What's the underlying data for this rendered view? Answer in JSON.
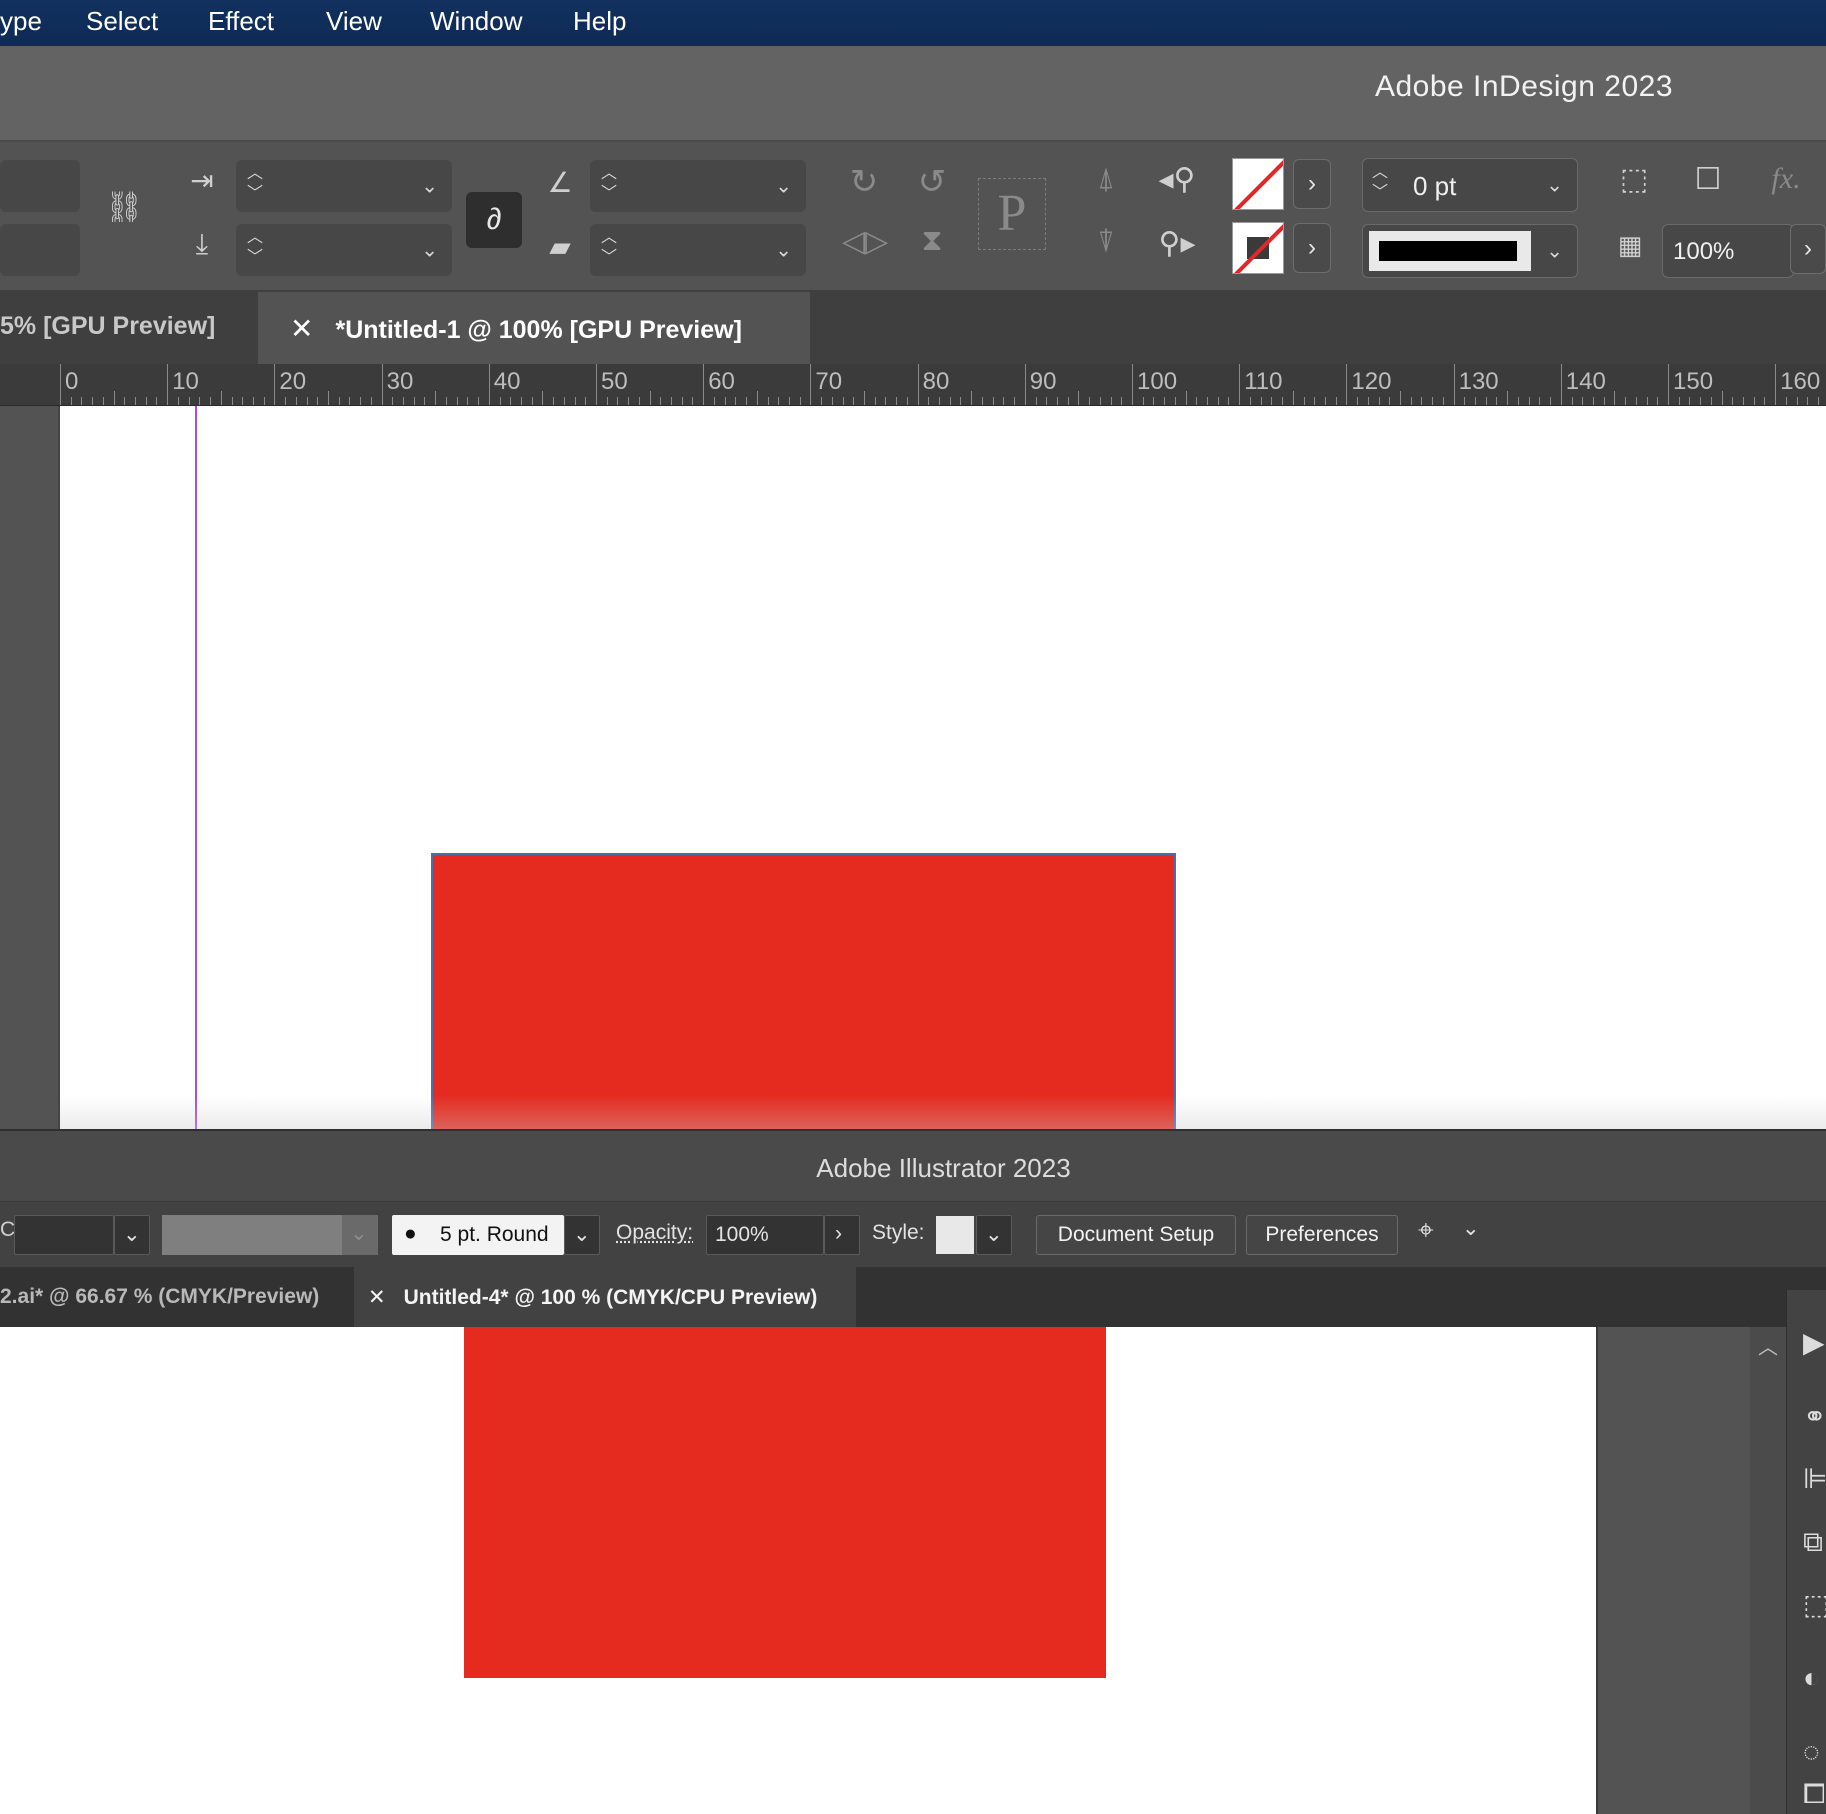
{
  "menubar": {
    "items": [
      "ype",
      "Select",
      "Effect",
      "View",
      "Window",
      "Help"
    ]
  },
  "indesign": {
    "app_title": "Adobe InDesign 2023",
    "control": {
      "stroke_weight": "0 pt",
      "opacity": "100%",
      "fx_label": "fx.",
      "paragraph_icon": "P"
    },
    "tabs": [
      {
        "label": "5% [GPU Preview]",
        "active": false
      },
      {
        "label": "*Untitled-1 @ 100% [GPU Preview]",
        "active": true
      }
    ],
    "ruler_labels": [
      "0",
      "10",
      "20",
      "30",
      "40",
      "50",
      "60",
      "70",
      "80",
      "90",
      "100",
      "110",
      "120",
      "130",
      "140",
      "150",
      "160"
    ],
    "rect_color": "#e52b20",
    "margin_guide_color": "#b14ad6"
  },
  "illustrator": {
    "app_title": "Adobe Illustrator 2023",
    "control": {
      "brush": "5 pt. Round",
      "opacity_label": "Opacity:",
      "opacity_value": "100%",
      "style_label": "Style:",
      "document_setup": "Document Setup",
      "preferences": "Preferences"
    },
    "tabs": [
      {
        "label": "2.ai* @ 66.67 % (CMYK/Preview)",
        "active": false
      },
      {
        "label": "Untitled-4* @ 100 % (CMYK/CPU Preview)",
        "active": true
      }
    ],
    "rect_color": "#e52b20"
  }
}
